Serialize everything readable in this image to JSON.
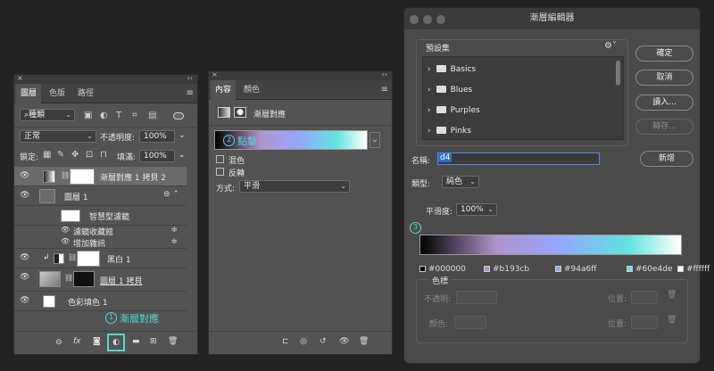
{
  "layers_panel": {
    "tabs": [
      "圖層",
      "色版",
      "路徑"
    ],
    "filter_kind": "種類",
    "blend_mode": "正常",
    "opacity_label": "不透明度:",
    "opacity_value": "100%",
    "lock_label": "鎖定:",
    "fill_label": "填滿:",
    "fill_value": "100%",
    "layers": [
      {
        "name": "漸層對應 1 拷貝 2"
      },
      {
        "name": "圖層 1"
      },
      {
        "name": "智慧型濾鏡"
      },
      {
        "name": "濾鏡收藏館"
      },
      {
        "name": "增加雜訊"
      },
      {
        "name": "黑白 1"
      },
      {
        "name": "圖層 1 拷貝"
      },
      {
        "name": "色彩填色 1"
      }
    ],
    "annotation_1_num": "1",
    "annotation_1_text": "漸層對應"
  },
  "properties_panel": {
    "tabs": [
      "內容",
      "顏色"
    ],
    "header": "漸層對應",
    "annotation_2_num": "2",
    "annotation_2_text": "點擊",
    "dither_label": "混色",
    "reverse_label": "反轉",
    "method_label": "方式:",
    "method_value": "平滑"
  },
  "gradient_editor": {
    "title": "漸層編輯器",
    "presets_label": "預設集",
    "presets": [
      "Basics",
      "Blues",
      "Purples",
      "Pinks"
    ],
    "ok": "確定",
    "cancel": "取消",
    "load": "讀入...",
    "save": "轉存...",
    "name_label": "名稱:",
    "name_value": "d4",
    "new": "新增",
    "type_label": "類型:",
    "type_value": "純色",
    "smooth_label": "平滑度:",
    "smooth_value": "100%",
    "annotation_3_num": "3",
    "stops": [
      "#000000",
      "#b193cb",
      "#94a6ff",
      "#60e4de",
      "#ffffff"
    ],
    "color_stop_label": "色標",
    "stop_opacity_label": "不透明:",
    "stop_location_label": "位置:",
    "stop_color_label": "顏色:",
    "stop_location_label2": "位置:"
  }
}
